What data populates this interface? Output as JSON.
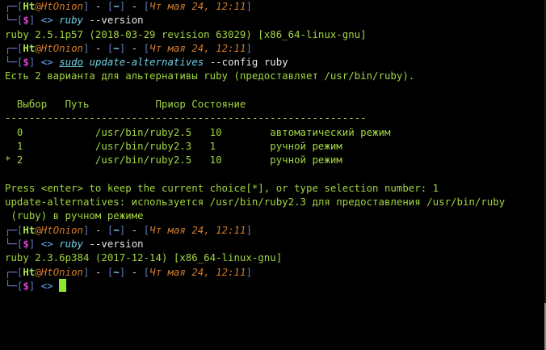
{
  "prompt": {
    "corner_top": "┌─",
    "corner_bottom": "└─",
    "bracket_open": "[",
    "bracket_close": "]",
    "user": "Ht",
    "at": "@",
    "host": "HtOnion",
    "sep": " - ",
    "cwd": "~",
    "datetime": "Чт мая 24, 12:11",
    "dollar": "$",
    "arrow": "<>"
  },
  "blocks": [
    {
      "command_name": "ruby",
      "command_args": " --version",
      "output": [
        "ruby 2.5.1p57 (2018-03-29 revision 63029) [x86_64-linux-gnu]"
      ]
    },
    {
      "command_sudo": "sudo",
      "command_name": "update-alternatives",
      "command_args": " --config ruby",
      "output": [
        "Есть 2 варианта для альтернативы ruby (предоставляет /usr/bin/ruby).",
        "",
        "  Выбор   Путь           Приор Состояние",
        "------------------------------------------------------------",
        "  0            /usr/bin/ruby2.5   10        автоматический режим",
        "  1            /usr/bin/ruby2.3   1         ручной режим",
        "* 2            /usr/bin/ruby2.5   10        ручной режим",
        "",
        "Press <enter> to keep the current choice[*], or type selection number: 1",
        "update-alternatives: используется /usr/bin/ruby2.3 для предоставления /usr/bin/ruby",
        " (ruby) в ручном режиме"
      ]
    },
    {
      "command_name": "ruby",
      "command_args": " --version",
      "output": [
        "ruby 2.3.6p384 (2017-12-14) [x86_64-linux-gnu]"
      ]
    }
  ],
  "colors": {
    "background": "#000000",
    "output_text": "#a0d53f",
    "user": "#a0e04a",
    "host": "#d07a2a",
    "cwd": "#7ed3f0",
    "dollar": "#e040e0",
    "command": "#6fd0e8",
    "cursor": "#8bea2f"
  }
}
